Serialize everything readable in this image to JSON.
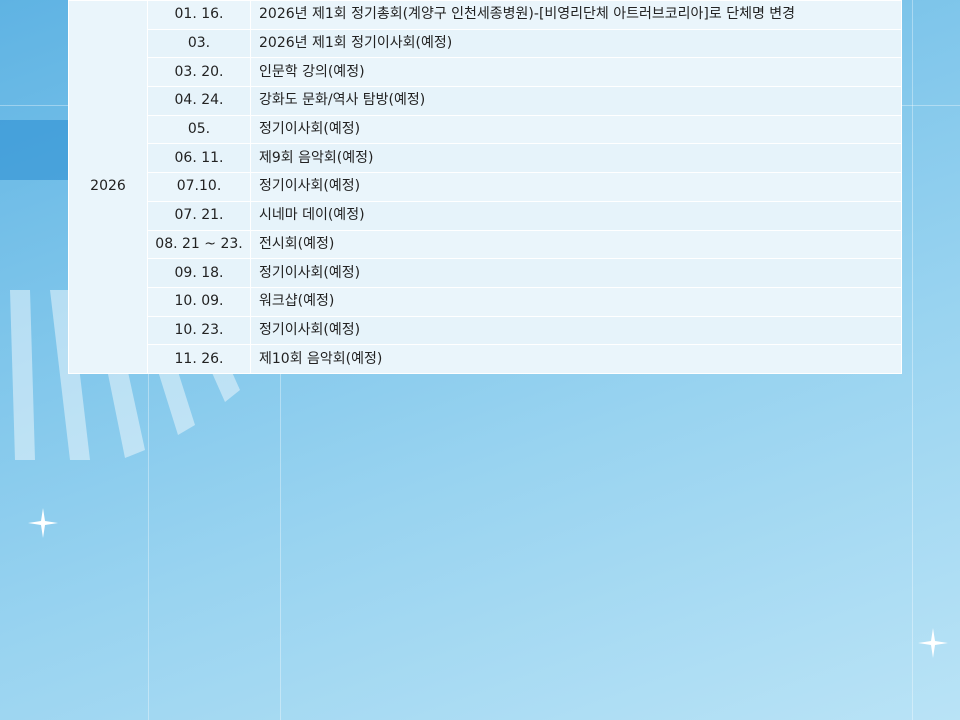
{
  "schedule": {
    "year": "2026",
    "rows": [
      {
        "date": "01. 16.",
        "event": "2026년 제1회 정기총회(계양구 인천세종병원)-[비영리단체 아트러브코리아]로 단체명 변경"
      },
      {
        "date": "03.",
        "event": "2026년 제1회 정기이사회(예정)"
      },
      {
        "date": "03. 20.",
        "event": "인문학 강의(예정)"
      },
      {
        "date": "04. 24.",
        "event": "강화도 문화/역사 탐방(예정)"
      },
      {
        "date": "05.",
        "event": "정기이사회(예정)"
      },
      {
        "date": "06. 11.",
        "event": "제9회 음악회(예정)"
      },
      {
        "date": "07.10.",
        "event": "정기이사회(예정)"
      },
      {
        "date": "07. 21.",
        "event": "시네마 데이(예정)"
      },
      {
        "date": "08. 21 ~ 23.",
        "event": "전시회(예정)"
      },
      {
        "date": "09. 18.",
        "event": "정기이사회(예정)"
      },
      {
        "date": "10. 09.",
        "event": "워크샵(예정)"
      },
      {
        "date": "10. 23.",
        "event": "정기이사회(예정)"
      },
      {
        "date": "11. 26.",
        "event": "제10회 음악회(예정)"
      }
    ]
  },
  "colors": {
    "table_bg": "#eaf5fb",
    "border": "#ffffff",
    "background_top": "#5fb3e3",
    "background_bottom": "#b9e3f6"
  },
  "icons": [
    "sparkle-icon",
    "sparkle-icon"
  ]
}
